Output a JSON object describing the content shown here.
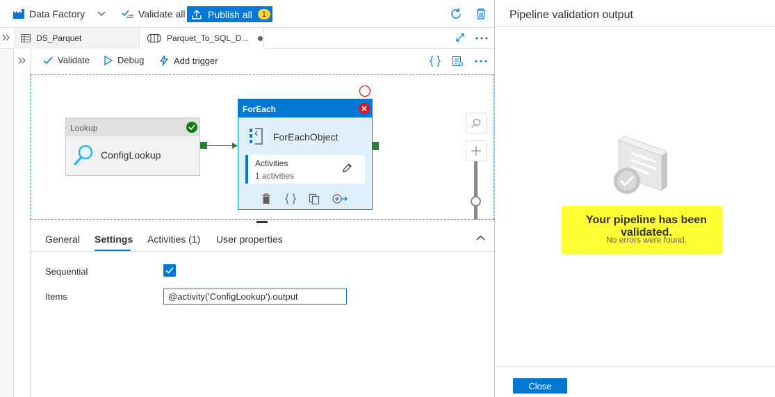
{
  "topbar": {
    "factory_label": "Data Factory",
    "validate_all": "Validate all",
    "publish_all": "Publish all",
    "publish_count": "1"
  },
  "tabs": [
    {
      "label": "DS_Parquet"
    },
    {
      "label": "Parquet_To_SQL_D..."
    }
  ],
  "toolbar": {
    "validate": "Validate",
    "debug": "Debug",
    "add_trigger": "Add trigger"
  },
  "canvas": {
    "lookup": {
      "type": "Lookup",
      "name": "ConfigLookup"
    },
    "foreach": {
      "type": "ForEach",
      "name": "ForEachObject",
      "activities_label": "Activities",
      "activities_count": "1 activities"
    }
  },
  "properties": {
    "tabs": [
      "General",
      "Settings",
      "Activities (1)",
      "User properties"
    ],
    "active_tab": "Settings",
    "sequential_label": "Sequential",
    "sequential_checked": true,
    "items_label": "Items",
    "items_value": "@activity('ConfigLookup').output"
  },
  "right_panel": {
    "title": "Pipeline validation output",
    "message": "Your pipeline has been validated.",
    "submessage": "No errors were found.",
    "close": "Close"
  },
  "colors": {
    "accent": "#0078d4",
    "success": "#107c10",
    "error": "#e81123",
    "highlight": "#ffff33",
    "activity_green": "#2d7d3a"
  }
}
